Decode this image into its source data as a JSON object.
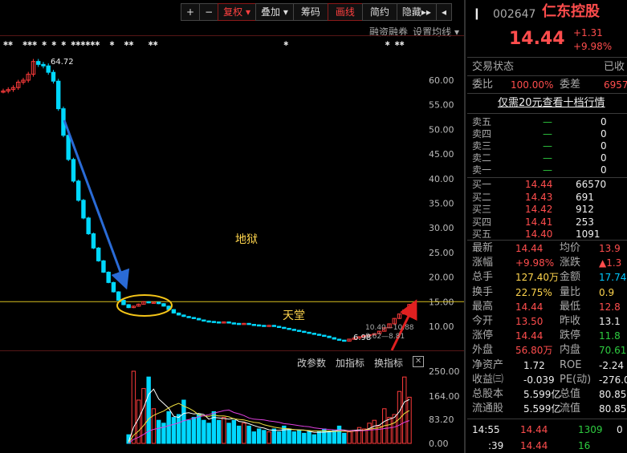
{
  "toolbar": {
    "plus": "+",
    "minus": "−",
    "fuquan": "复权",
    "diejia": "叠加",
    "chouma": "筹码",
    "huaxian": "画线",
    "jianyue": "简约",
    "yincang": "隐藏",
    "arrows": "▸▸",
    "collapse": "◂"
  },
  "chart_options": {
    "margin_trading": "融资融券",
    "ma_settings": "设置均线"
  },
  "star_marks": "✱✱  ✱✱✱ ✱ ✱ ✱ ✱✱✱✱✱✱  ✱  ✱✱   ✱✱                          ✱                    ✱ ✱✱",
  "annotations": {
    "peak": "64.72",
    "low": "6.98",
    "right_labels": [
      "10.40—10.88",
      "8.62—8.81"
    ],
    "hell": "地狱",
    "heaven": "天堂"
  },
  "lower_tools": {
    "change_params": "改参数",
    "add_indicator": "加指标",
    "switch_indicator": "换指标",
    "close": "✕"
  },
  "colors": {
    "up": "#ff3b3b",
    "down": "#00d8ff",
    "hell": "#ffd54d",
    "arrow_blue": "#2a6bd6",
    "arrow_red": "#e02020",
    "ellipse": "#f5c518"
  },
  "chart_data": [
    {
      "type": "candlestick",
      "ylim": [
        6,
        67
      ],
      "yticks": [
        "60.00",
        "55.00",
        "50.00",
        "45.00",
        "40.00",
        "35.00",
        "30.00",
        "25.00",
        "20.00",
        "15.00",
        "10.00"
      ],
      "reference_line": 15.0,
      "closes": [
        57.8,
        58.1,
        58.5,
        59.6,
        60.0,
        61.2,
        63.8,
        63.2,
        62.9,
        61.6,
        59.8,
        54.2,
        48.8,
        43.9,
        39.5,
        35.6,
        32.0,
        28.8,
        25.9,
        23.3,
        21.0,
        18.9,
        17.0,
        15.3,
        14.4,
        13.8,
        14.1,
        14.5,
        15.0,
        14.8,
        14.9,
        14.6,
        14.1,
        13.4,
        12.7,
        12.3,
        12.0,
        11.8,
        11.6,
        11.3,
        11.1,
        11.0,
        10.9,
        10.8,
        10.9,
        10.7,
        10.6,
        10.5,
        10.6,
        10.4,
        10.3,
        10.2,
        10.1,
        10.2,
        10.0,
        9.8,
        9.6,
        9.4,
        9.2,
        9.0,
        8.8,
        8.6,
        8.4,
        8.2,
        8.0,
        7.7,
        7.4,
        7.2,
        7.0,
        7.4,
        7.6,
        7.9,
        8.1,
        8.3,
        8.5,
        9.0,
        9.7,
        10.5,
        11.6,
        12.5,
        13.3,
        14.44
      ]
    },
    {
      "type": "bar",
      "ylim": [
        0,
        250
      ],
      "yticks": [
        "250.00",
        "164.00",
        "83.20",
        "0.00"
      ],
      "values": [
        0,
        0,
        0,
        0,
        0,
        0,
        0,
        0,
        0,
        0,
        0,
        0,
        0,
        0,
        0,
        0,
        0,
        0,
        0,
        0,
        0,
        0,
        0,
        0,
        0,
        30,
        250,
        150,
        190,
        230,
        120,
        80,
        70,
        110,
        90,
        100,
        150,
        80,
        90,
        100,
        80,
        70,
        110,
        80,
        90,
        70,
        80,
        60,
        70,
        60,
        40,
        50,
        45,
        40,
        50,
        40,
        60,
        50,
        40,
        45,
        35,
        40,
        30,
        40,
        50,
        40,
        45,
        60,
        35,
        40,
        45,
        55,
        50,
        70,
        80,
        60,
        120,
        90,
        100,
        180,
        230,
        160
      ]
    }
  ],
  "stock": {
    "code": "002647",
    "name": "仁东控股",
    "price": "14.44",
    "change": "+1.31",
    "change_pct": "+9.98%"
  },
  "status": {
    "label": "交易状态",
    "value": "已收"
  },
  "commission": {
    "ratio_label": "委比",
    "ratio_value": "100.00%",
    "diff_label": "委差",
    "diff_value": "6957"
  },
  "promo": "仅需20元查看十档行情",
  "sells": [
    {
      "label": "卖五",
      "price": "—",
      "vol": "0"
    },
    {
      "label": "卖四",
      "price": "—",
      "vol": "0"
    },
    {
      "label": "卖三",
      "price": "—",
      "vol": "0"
    },
    {
      "label": "卖二",
      "price": "—",
      "vol": "0"
    },
    {
      "label": "卖一",
      "price": "—",
      "vol": "0"
    }
  ],
  "buys": [
    {
      "label": "买一",
      "price": "14.44",
      "vol": "66570"
    },
    {
      "label": "买二",
      "price": "14.43",
      "vol": "691"
    },
    {
      "label": "买三",
      "price": "14.42",
      "vol": "912"
    },
    {
      "label": "买四",
      "price": "14.41",
      "vol": "253"
    },
    {
      "label": "买五",
      "price": "14.40",
      "vol": "1091"
    }
  ],
  "stats": [
    {
      "l1": "最新",
      "v1": "14.44",
      "c1": "red",
      "l2": "均价",
      "v2": "13.9",
      "c2": "red"
    },
    {
      "l1": "涨幅",
      "v1": "+9.98%",
      "c1": "red",
      "l2": "涨跌",
      "v2": "▲1.3",
      "c2": "red"
    },
    {
      "l1": "总手",
      "v1": "127.40万",
      "c1": "yellow",
      "l2": "金额",
      "v2": "17.74",
      "c2": "cyan"
    },
    {
      "l1": "换手",
      "v1": "22.75%",
      "c1": "yellow",
      "l2": "量比",
      "v2": "0.9",
      "c2": "yellow"
    },
    {
      "l1": "最高",
      "v1": "14.44",
      "c1": "red",
      "l2": "最低",
      "v2": "12.8",
      "c2": "red"
    },
    {
      "l1": "今开",
      "v1": "13.50",
      "c1": "red",
      "l2": "昨收",
      "v2": "13.1",
      "c2": "white"
    },
    {
      "l1": "涨停",
      "v1": "14.44",
      "c1": "red",
      "l2": "跌停",
      "v2": "11.8",
      "c2": "green"
    },
    {
      "l1": "外盘",
      "v1": "56.80万",
      "c1": "red",
      "l2": "内盘",
      "v2": "70.61",
      "c2": "green"
    },
    {
      "l1": "净资产",
      "v1": "1.72",
      "c1": "white",
      "l2": "ROE",
      "v2": "-2.24",
      "c2": "white"
    },
    {
      "l1": "收益㈢",
      "v1": "-0.039",
      "c1": "white",
      "l2": "PE(动)",
      "v2": "-276.0",
      "c2": "white"
    },
    {
      "l1": "总股本",
      "v1": "5.599亿",
      "c1": "white",
      "l2": "总值",
      "v2": "80.85",
      "c2": "white"
    },
    {
      "l1": "流通股",
      "v1": "5.599亿",
      "c1": "white",
      "l2": "流值",
      "v2": "80.85",
      "c2": "white"
    }
  ],
  "ticks": [
    {
      "time": "14:55",
      "price": "14.44",
      "vol": "1309",
      "flag": "0"
    },
    {
      "time": ":39",
      "price": "14.44",
      "vol": "16",
      "flag": ""
    }
  ]
}
